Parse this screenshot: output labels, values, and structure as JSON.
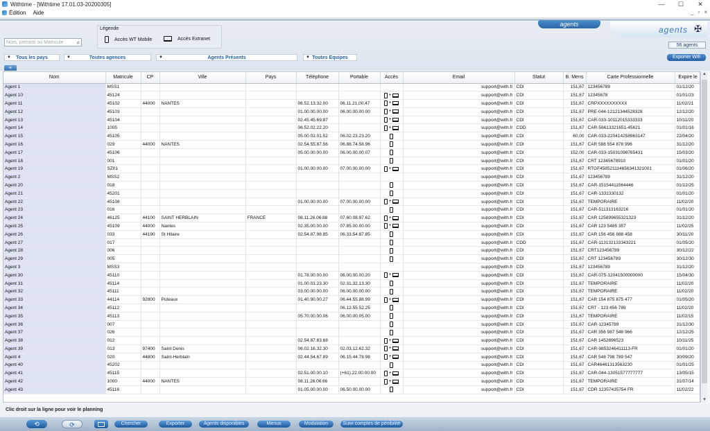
{
  "window": {
    "title": "Withtime - [Withtime 17.01.03-20200305]",
    "minimize": "—",
    "maximize": "☐",
    "close": "✕"
  },
  "menubar": {
    "items": [
      "Édition",
      "Aide"
    ],
    "mdi": {
      "minimize": "_",
      "restore": "▫",
      "close": "×"
    }
  },
  "search": {
    "placeholder": "Nom, prénom ou Matricule"
  },
  "legend": {
    "title": "Légende",
    "mobile": "Accès WT Mobile",
    "extranet": "Accès Extranet"
  },
  "logo": {
    "tab": "agents",
    "main": "agents"
  },
  "agent_count": "56 agents",
  "filters": {
    "pays": "Tous les pays",
    "agences": "Toutes agences",
    "presents": "Agents Présents",
    "equipes": "Toutes Equipes"
  },
  "export_button": "Exporter Wifi",
  "add_tab": "+",
  "table": {
    "columns": [
      "Nom",
      "Matricule",
      "CP",
      "Ville",
      "Pays",
      "Téléphone",
      "Portable",
      "Accès",
      "Email",
      "Statut",
      "B. Mens",
      "Carte Professionnelle",
      "Expire le"
    ],
    "rows": [
      {
        "nom": "Agent 1",
        "mat": "MSS1",
        "cp": "",
        "ville": "",
        "pays": "",
        "tel": "",
        "port": "",
        "acces": "",
        "email": "support@with.fr",
        "statut": "CDI",
        "bmens": "151,67",
        "carte": "123456789",
        "expire": "01/12/20"
      },
      {
        "nom": "Agent 10",
        "mat": "45124",
        "cp": "",
        "ville": "",
        "pays": "",
        "tel": "",
        "port": "",
        "acces": "ML",
        "email": "support@with.fr",
        "statut": "CDI",
        "bmens": "151,67",
        "carte": "12345678",
        "expire": "01/01/23"
      },
      {
        "nom": "Agent 11",
        "mat": "45102",
        "cp": "44000",
        "ville": "NANTES",
        "pays": "",
        "tel": "06.52.13.32.00",
        "port": "06.11.21.00.47",
        "acces": "ML",
        "email": "support@with.fr",
        "statut": "CDI",
        "bmens": "151,67",
        "carte": "CRPXXXXXXXXXX",
        "expire": "11/02/21"
      },
      {
        "nom": "Agent 12",
        "mat": "45103",
        "cp": "",
        "ville": "",
        "pays": "",
        "tel": "01.00.00.00.00",
        "port": "06.00.00.00.00",
        "acces": "ML",
        "email": "support@with.fr",
        "statut": "CDI",
        "bmens": "151,67",
        "carte": "PRE-044-12121344528328",
        "expire": "12/12/20"
      },
      {
        "nom": "Agent 13",
        "mat": "45104",
        "cp": "",
        "ville": "",
        "pays": "",
        "tel": "02.45.45.69.87",
        "port": "",
        "acces": "ML",
        "email": "support@with.fr",
        "statut": "CDI",
        "bmens": "151,67",
        "carte": "CAR-033-10112015333333",
        "expire": "10/11/20"
      },
      {
        "nom": "Agent 14",
        "mat": "1005",
        "cp": "",
        "ville": "",
        "pays": "",
        "tel": "06.52.02.22.20",
        "port": "",
        "acces": "ML",
        "email": "support@with.fr",
        "statut": "CDD",
        "bmens": "151,67",
        "carte": "CAR-56613321651-45621",
        "expire": "01/01/16"
      },
      {
        "nom": "Agent 15",
        "mat": "45105",
        "cp": "",
        "ville": "",
        "pays": "",
        "tel": "05.00.02.01.52",
        "port": "06.02.23.23.20",
        "acces": "M",
        "email": "support@with.fr",
        "statut": "CDI",
        "bmens": "60,00",
        "carte": "CAR-033-220414258963147",
        "expire": "22/04/20"
      },
      {
        "nom": "Agent 16",
        "mat": "029",
        "cp": "44000",
        "ville": "NANTES",
        "pays": "",
        "tel": "02.54.55.87.56",
        "port": "06.88.74.58.96",
        "acces": "M",
        "email": "support@with.fr",
        "statut": "CDI",
        "bmens": "151,67",
        "carte": "CAR 588 554 878 996",
        "expire": "31/12/20"
      },
      {
        "nom": "Agent 17",
        "mat": "45106",
        "cp": "",
        "ville": "",
        "pays": "",
        "tel": "05.00.00.00.00",
        "port": "06.00.00.00.07",
        "acces": "M",
        "email": "support@with.fr",
        "statut": "CDI",
        "bmens": "152,00",
        "carte": "CAR-033-15031098765431",
        "expire": "15/03/20"
      },
      {
        "nom": "Agent 18",
        "mat": "001",
        "cp": "",
        "ville": "",
        "pays": "",
        "tel": "",
        "port": "",
        "acces": "M",
        "email": "support@with.fr",
        "statut": "CDI",
        "bmens": "151,67",
        "carte": "CRT 12345678910",
        "expire": "01/01/20"
      },
      {
        "nom": "Agent 19",
        "mat": "SZ01",
        "cp": "",
        "ville": "",
        "pays": "",
        "tel": "01.00.00.00.00",
        "port": "07.00.00.00.00",
        "acces": "ML",
        "email": "support@with.fr",
        "statut": "CDI",
        "bmens": "151,67",
        "carte": "RTGF45852111465634132100​1",
        "expire": "01/06/20"
      },
      {
        "nom": "Agent 2",
        "mat": "MSS2",
        "cp": "",
        "ville": "",
        "pays": "",
        "tel": "",
        "port": "",
        "acces": "",
        "email": "support@with.fr",
        "statut": "CDI",
        "bmens": "151,67",
        "carte": "123456789",
        "expire": "31/12/20"
      },
      {
        "nom": "Agent 20",
        "mat": "018",
        "cp": "",
        "ville": "",
        "pays": "",
        "tel": "",
        "port": "",
        "acces": "M",
        "email": "support@with.fr",
        "statut": "CDI",
        "bmens": "151,67",
        "carte": "CAR-15154411564446",
        "expire": "01/12/25"
      },
      {
        "nom": "Agent 21",
        "mat": "45201",
        "cp": "",
        "ville": "",
        "pays": "",
        "tel": "",
        "port": "",
        "acces": "M",
        "email": "support@with.fr",
        "statut": "CDI",
        "bmens": "151,67",
        "carte": "CAR-1331330132",
        "expire": "01/01/20"
      },
      {
        "nom": "Agent 22",
        "mat": "45108",
        "cp": "",
        "ville": "",
        "pays": "",
        "tel": "01.00.00.00.00",
        "port": "07.00.00.00.00",
        "acces": "ML",
        "email": "support@with.fr",
        "statut": "CDI",
        "bmens": "151,67",
        "carte": "TEMPORAIRE",
        "expire": "11/02/20"
      },
      {
        "nom": "Agent 23",
        "mat": "016",
        "cp": "",
        "ville": "",
        "pays": "",
        "tel": "",
        "port": "",
        "acces": "M",
        "email": "support@with.fr",
        "statut": "CDI",
        "bmens": "151,67",
        "carte": "CAR-511313163216",
        "expire": "01/01/20"
      },
      {
        "nom": "Agent 24",
        "mat": "46125",
        "cp": "44100",
        "ville": "SAINT HERBLAIN",
        "pays": "FRANCE",
        "tel": "08.11.26.06.88",
        "port": "07.60.08.97.62",
        "acces": "ML",
        "email": "support@with.fr",
        "statut": "CDI",
        "bmens": "151,67",
        "carte": "CAR 125899655321323",
        "expire": "31/12/20"
      },
      {
        "nom": "Agent 25",
        "mat": "45109",
        "cp": "44000",
        "ville": "Nantes",
        "pays": "",
        "tel": "02.35.00.00.00",
        "port": "07.85.00.00.00",
        "acces": "ML",
        "email": "support@with.fr",
        "statut": "CDI",
        "bmens": "151,67",
        "carte": "CAR 123 5485 357",
        "expire": "11/02/25"
      },
      {
        "nom": "Agent 26",
        "mat": "033",
        "cp": "44190",
        "ville": "St Hilaire",
        "pays": "",
        "tel": "02.54.87.98.85",
        "port": "06.33.54.87.85",
        "acces": "M",
        "email": "support@with.fr",
        "statut": "CDI",
        "bmens": "151,67",
        "carte": "CAR 156 456 888 458",
        "expire": "30/11/20"
      },
      {
        "nom": "Agent 27",
        "mat": "017",
        "cp": "",
        "ville": "",
        "pays": "",
        "tel": "",
        "port": "",
        "acces": "M",
        "email": "support@with.fr",
        "statut": "CDD",
        "bmens": "151,67",
        "carte": "CAR-113132133343221",
        "expire": "01/05/20"
      },
      {
        "nom": "Agent 28",
        "mat": "006",
        "cp": "",
        "ville": "",
        "pays": "",
        "tel": "",
        "port": "",
        "acces": "M",
        "email": "support@with.fr",
        "statut": "CDI",
        "bmens": "151,67",
        "carte": "CRT123456789",
        "expire": "30/12/22"
      },
      {
        "nom": "Agent 29",
        "mat": "005",
        "cp": "",
        "ville": "",
        "pays": "",
        "tel": "",
        "port": "",
        "acces": "M",
        "email": "support@with.fr",
        "statut": "CDI",
        "bmens": "151,67",
        "carte": "CRT 123456789",
        "expire": "30/12/30"
      },
      {
        "nom": "Agent 3",
        "mat": "MSS3",
        "cp": "",
        "ville": "",
        "pays": "",
        "tel": "",
        "port": "",
        "acces": "",
        "email": "support@with.fr",
        "statut": "CDI",
        "bmens": "151,67",
        "carte": "123456789",
        "expire": "31/12/20"
      },
      {
        "nom": "Agent 30",
        "mat": "45110",
        "cp": "",
        "ville": "",
        "pays": "",
        "tel": "01.78.00.00.00",
        "port": "06.00.00.00.20",
        "acces": "ML",
        "email": "support@with.fr",
        "statut": "CDI",
        "bmens": "151,67",
        "carte": "CAR-075-12041500000000",
        "expire": "15/04/30"
      },
      {
        "nom": "Agent 31",
        "mat": "45114",
        "cp": "",
        "ville": "",
        "pays": "",
        "tel": "01.00.03.23.30",
        "port": "02.31.32.13.30",
        "acces": "M",
        "email": "support@with.fr",
        "statut": "CDI",
        "bmens": "151,67",
        "carte": "TEMPORAIRE",
        "expire": "11/02/20"
      },
      {
        "nom": "Agent 32",
        "mat": "45111",
        "cp": "",
        "ville": "",
        "pays": "",
        "tel": "03.00.00.00.00",
        "port": "06.00.00.00.00",
        "acces": "M",
        "email": "support@with.fr",
        "statut": "CDI",
        "bmens": "151,67",
        "carte": "TEMPORAIRE",
        "expire": "11/02/20"
      },
      {
        "nom": "Agent 33",
        "mat": "44114",
        "cp": "92800",
        "ville": "Puteaux",
        "pays": "",
        "tel": "01.40.90.00.27",
        "port": "06.44.55.88.99",
        "acces": "ML",
        "email": "support@with.fr",
        "statut": "CDI",
        "bmens": "151,67",
        "carte": "CAR 154 875 875 477",
        "expire": "01/05/20"
      },
      {
        "nom": "Agent 34",
        "mat": "45112",
        "cp": "",
        "ville": "",
        "pays": "",
        "tel": "",
        "port": "06.12.55.52.25",
        "acces": "M",
        "email": "support@with.fr",
        "statut": "CDI",
        "bmens": "151,67",
        "carte": "CRT - 123 456 789",
        "expire": "11/02/20"
      },
      {
        "nom": "Agent 35",
        "mat": "45113",
        "cp": "",
        "ville": "",
        "pays": "",
        "tel": "05.70.00.00.06",
        "port": "06.00.00.05.00",
        "acces": "M",
        "email": "support@with.fr",
        "statut": "CDI",
        "bmens": "151,67",
        "carte": "TEMPORAIRE",
        "expire": "11/02/15"
      },
      {
        "nom": "Agent 36",
        "mat": "007",
        "cp": "",
        "ville": "",
        "pays": "",
        "tel": "",
        "port": "",
        "acces": "M",
        "email": "support@with.fr",
        "statut": "CDI",
        "bmens": "151,67",
        "carte": "CAR-12345789",
        "expire": "31/12/30"
      },
      {
        "nom": "Agent 37",
        "mat": "026",
        "cp": "",
        "ville": "",
        "pays": "",
        "tel": "",
        "port": "",
        "acces": "M",
        "email": "support@with.fr",
        "statut": "CDI",
        "bmens": "151,67",
        "carte": "CAR 356 987 548 966",
        "expire": "12/12/25"
      },
      {
        "nom": "Agent 38",
        "mat": "012",
        "cp": "",
        "ville": "",
        "pays": "",
        "tel": "02.54.87.83.68",
        "port": "",
        "acces": "ML",
        "email": "support@with.fr",
        "statut": "CDI",
        "bmens": "151,67",
        "carte": "CAR 1452896523",
        "expire": "10/11/25"
      },
      {
        "nom": "Agent 39",
        "mat": "013",
        "cp": "97400",
        "ville": "Saint Denis",
        "pays": "",
        "tel": "06.02.16.32.30",
        "port": "02.03.12.62.32",
        "acces": "ML",
        "email": "support@with.fr",
        "statut": "CDI",
        "bmens": "151,67",
        "carte": "CAR-9853246411113-FR",
        "expire": "01/01/20"
      },
      {
        "nom": "Agent 4",
        "mat": "020",
        "cp": "44800",
        "ville": "Saint-Herblain",
        "pays": "",
        "tel": "02.44.54.67.89",
        "port": "06.15.44.78.98",
        "acces": "ML",
        "email": "support@with.fr",
        "statut": "CDI",
        "bmens": "151,67",
        "carte": "CAR 548 798 789 547",
        "expire": "30/09/20"
      },
      {
        "nom": "Agent 40",
        "mat": "45202",
        "cp": "",
        "ville": "",
        "pays": "",
        "tel": "",
        "port": "",
        "acces": "M",
        "email": "support@with.fr",
        "statut": "CDI",
        "bmens": "151,67",
        "carte": "CAR46461313563230",
        "expire": "01/01/25"
      },
      {
        "nom": "Agent 41",
        "mat": "45115",
        "cp": "",
        "ville": "",
        "pays": "",
        "tel": "02.51.00.00.10",
        "port": "(+61).22.00.00.00",
        "acces": "ML",
        "email": "support@with.fr",
        "statut": "CDI",
        "bmens": "151,67",
        "carte": "CAR-044-1305157777777​7",
        "expire": "13/05/15"
      },
      {
        "nom": "Agent 42",
        "mat": "1000",
        "cp": "44000",
        "ville": "NANTES",
        "pays": "",
        "tel": "08.11.26.06.66",
        "port": "",
        "acces": "ML",
        "email": "support@with.fr",
        "statut": "CDI",
        "bmens": "151,67",
        "carte": "TEMPORAIRE",
        "expire": "31/07/14"
      },
      {
        "nom": "Agent 43",
        "mat": "45116",
        "cp": "",
        "ville": "",
        "pays": "",
        "tel": "01.05.00.00.00",
        "port": "06.50.00.00.00",
        "acces": "M",
        "email": "support@with.fr",
        "statut": "CDI",
        "bmens": "151,67",
        "carte": "CDR 12357435754 FR",
        "expire": "11/02/22"
      }
    ]
  },
  "status_text": "Clic droit sur la ligne pour voir le planning",
  "footer": {
    "back": "⟲",
    "forward": "⟳",
    "buttons": [
      "Chercher",
      "Exporter",
      "Agents disponibles",
      "Menus",
      "Modulation",
      "Suivi comptes de pénibilité"
    ]
  }
}
